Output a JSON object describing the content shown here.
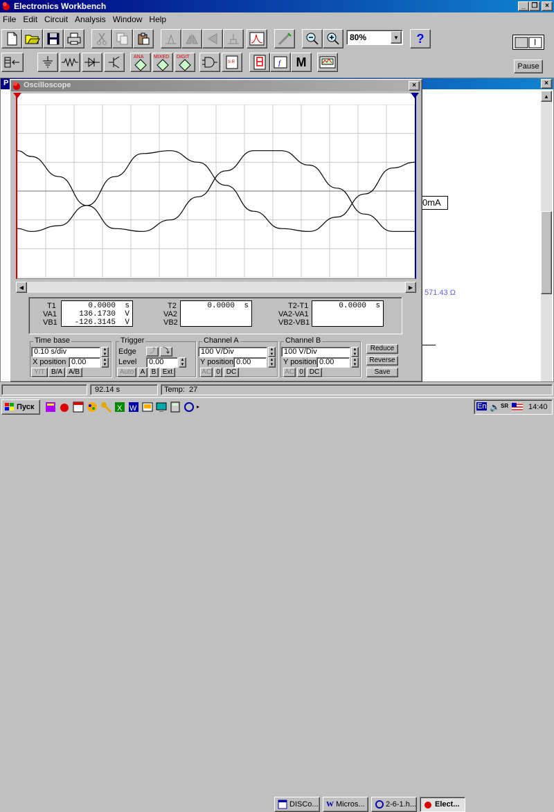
{
  "app": {
    "title": "Electronics Workbench",
    "window_buttons": [
      "_",
      "❐",
      "×"
    ]
  },
  "menu": [
    "File",
    "Edit",
    "Circuit",
    "Analysis",
    "Window",
    "Help"
  ],
  "toolbar": {
    "zoom_value": "80%",
    "help_label": "?",
    "pause_label": "Pause",
    "power_label": "I",
    "parts_bin": [
      "ANA",
      "MIXED",
      "DIGIT",
      "M"
    ]
  },
  "oscilloscope": {
    "title": "Oscilloscope",
    "close_label": "×",
    "marker1": "1",
    "marker2": "2",
    "readouts": {
      "t1_label": "T1",
      "va1_label": "VA1",
      "vb1_label": "VB1",
      "t1": "0.0000",
      "t1_unit": "s",
      "va1": "136.1730",
      "va1_unit": "V",
      "vb1": "-126.3145",
      "vb1_unit": "V",
      "t2_label": "T2",
      "va2_label": "VA2",
      "vb2_label": "VB2",
      "t2": "0.0000",
      "t2_unit": "s",
      "dt_label": "T2-T1",
      "dva_label": "VA2-VA1",
      "dvb_label": "VB2-VB1",
      "dt": "0.0000",
      "dt_unit": "s"
    },
    "timebase": {
      "title": "Time base",
      "value": "0.10 s/div",
      "xpos_label": "X position",
      "xpos": "0.00",
      "buttons": [
        "Y/T",
        "B/A",
        "A/B"
      ]
    },
    "trigger": {
      "title": "Trigger",
      "edge_label": "Edge",
      "level_label": "Level",
      "level": "0.00",
      "buttons": [
        "Auto",
        "A",
        "B",
        "Ext"
      ]
    },
    "channel_a": {
      "title": "Channel A",
      "value": "100 V/Div",
      "ypos_label": "Y position",
      "ypos": "0.00",
      "buttons": [
        "AC",
        "0",
        "DC"
      ]
    },
    "channel_b": {
      "title": "Channel B",
      "value": "100 V/Div",
      "ypos_label": "Y position",
      "ypos": "0.00",
      "buttons": [
        "AC",
        "0",
        "DC"
      ]
    },
    "side_buttons": [
      "Reduce",
      "Reverse",
      "Save"
    ]
  },
  "circuit": {
    "title_letter": "P",
    "close_label": "×",
    "ammeter": "0mA",
    "resistance": "571.43 Ω"
  },
  "statusbar": {
    "time": "92.14 s",
    "temp": "Temp:  27"
  },
  "taskbar": {
    "start": "Пуск",
    "tasks": [
      "DISCo...",
      "Micros...",
      "2-6-1.h...",
      "Elect..."
    ],
    "lang": "En",
    "clock": "14:40"
  },
  "chart_data": {
    "type": "line",
    "title": "",
    "xlabel": "",
    "ylabel": "",
    "x_divisions": 14,
    "y_divisions": 6,
    "series": [
      {
        "points": [
          [
            0.0,
            1.4
          ],
          [
            0.05,
            1.2
          ],
          [
            0.15,
            0.5
          ],
          [
            0.25,
            -0.5
          ],
          [
            0.35,
            -1.3
          ],
          [
            0.45,
            -1.4
          ],
          [
            0.55,
            -1.0
          ],
          [
            0.65,
            -0.2
          ],
          [
            0.75,
            0.7
          ],
          [
            0.85,
            1.4
          ],
          [
            0.95,
            1.4
          ],
          [
            1.05,
            0.9
          ],
          [
            1.15,
            0.1
          ],
          [
            1.25,
            -0.8
          ],
          [
            1.35,
            -1.4
          ],
          [
            1.43,
            -1.4
          ]
        ]
      },
      {
        "points": [
          [
            0.0,
            -1.3
          ],
          [
            0.05,
            -1.4
          ],
          [
            0.15,
            -1.2
          ],
          [
            0.25,
            -0.5
          ],
          [
            0.35,
            0.5
          ],
          [
            0.45,
            1.3
          ],
          [
            0.55,
            1.4
          ],
          [
            0.65,
            1.0
          ],
          [
            0.75,
            0.2
          ],
          [
            0.85,
            -0.7
          ],
          [
            0.95,
            -1.3
          ],
          [
            1.05,
            -1.4
          ],
          [
            1.15,
            -0.9
          ],
          [
            1.25,
            -0.1
          ],
          [
            1.35,
            0.8
          ],
          [
            1.43,
            1.0
          ]
        ]
      }
    ]
  }
}
